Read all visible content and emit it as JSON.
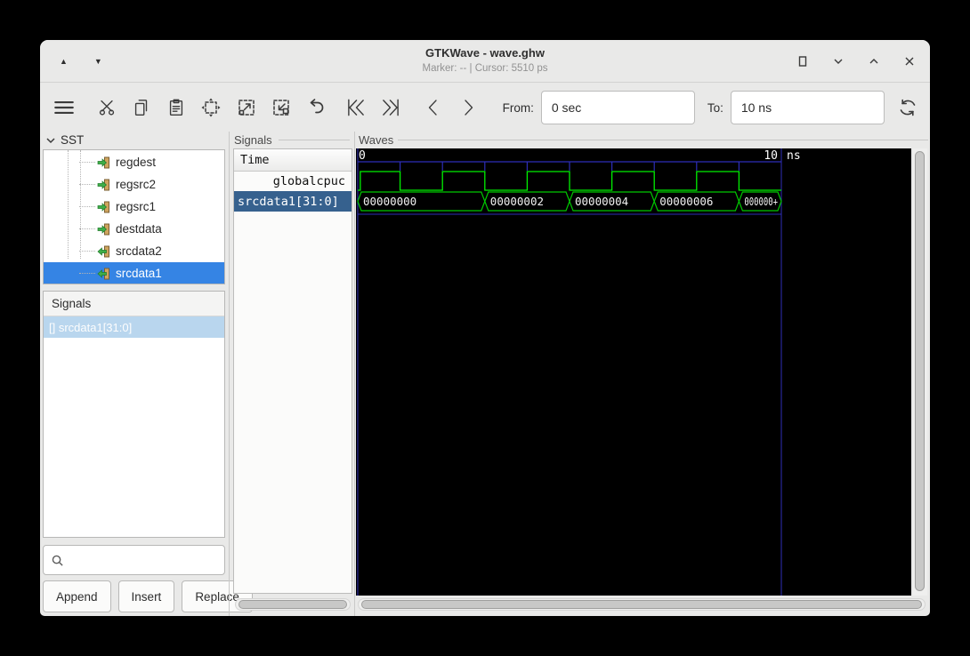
{
  "window": {
    "title": "GTKWave - wave.ghw",
    "subtitle": "Marker: --  |  Cursor: 5510 ps"
  },
  "toolbar": {
    "from_label": "From:",
    "from_value": "0 sec",
    "to_label": "To:",
    "to_value": "10 ns"
  },
  "sst": {
    "header": "SST",
    "items": [
      {
        "label": "regdest",
        "dir": "in",
        "selected": false
      },
      {
        "label": "regsrc2",
        "dir": "in",
        "selected": false
      },
      {
        "label": "regsrc1",
        "dir": "in",
        "selected": false
      },
      {
        "label": "destdata",
        "dir": "in",
        "selected": false
      },
      {
        "label": "srcdata2",
        "dir": "out",
        "selected": false
      },
      {
        "label": "srcdata1",
        "dir": "out",
        "selected": true
      }
    ],
    "signals_header": "Signals",
    "selected_signal": "[] srcdata1[31:0]",
    "search_value": "",
    "buttons": {
      "append": "Append",
      "insert": "Insert",
      "replace": "Replace"
    }
  },
  "signal_list": {
    "frame_label": "Signals",
    "time_header": "Time",
    "rows": [
      {
        "label": "globalcpuc",
        "selected": false
      },
      {
        "label": "srcdata1[31:0]",
        "selected": true
      }
    ]
  },
  "waves": {
    "frame_label": "Waves",
    "timeline": {
      "start_label": "0",
      "end_label": "10",
      "unit": "ns",
      "total_ns": 10,
      "tick_every_ns": 1
    },
    "clock": {
      "name": "globalcpuc",
      "rise_ns": [
        0.06,
        2,
        4,
        6,
        8
      ],
      "fall_ns": [
        1,
        3,
        5,
        7,
        9
      ]
    },
    "bus": {
      "name": "srcdata1[31:0]",
      "segments": [
        {
          "from_ns": 0,
          "to_ns": 3,
          "label": "00000000"
        },
        {
          "from_ns": 3,
          "to_ns": 5,
          "label": "00000002"
        },
        {
          "from_ns": 5,
          "to_ns": 7,
          "label": "00000004"
        },
        {
          "from_ns": 7,
          "to_ns": 9,
          "label": "00000006"
        },
        {
          "from_ns": 9,
          "to_ns": 10,
          "label": "000000+"
        }
      ]
    },
    "colors": {
      "background": "#000000",
      "grid": "#2e2eb8",
      "clock": "#00f000",
      "bus_outline": "#00c800",
      "value_text": "#f2f2f2",
      "timeline_text": "#ffffff"
    }
  }
}
